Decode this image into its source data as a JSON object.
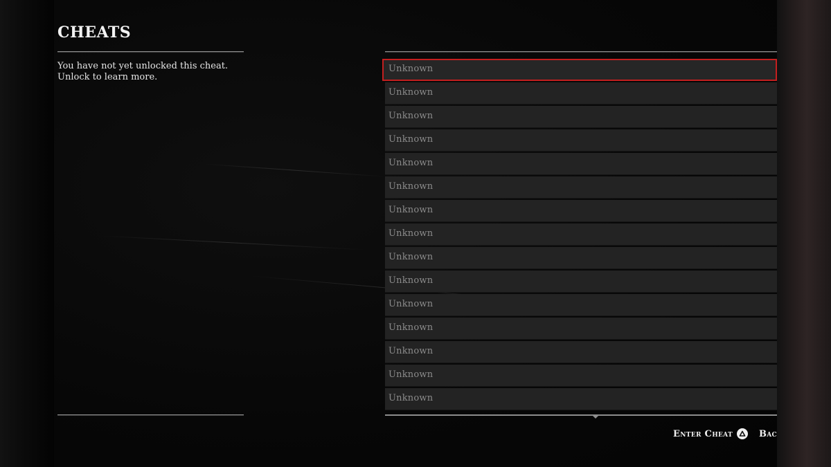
{
  "panel": {
    "title": "CHEATS",
    "description_line1": "You have not yet unlocked this cheat.",
    "description_line2": "Unlock to learn more."
  },
  "cheat_list": {
    "selected_index": 0,
    "items": [
      {
        "label": "Unknown"
      },
      {
        "label": "Unknown"
      },
      {
        "label": "Unknown"
      },
      {
        "label": "Unknown"
      },
      {
        "label": "Unknown"
      },
      {
        "label": "Unknown"
      },
      {
        "label": "Unknown"
      },
      {
        "label": "Unknown"
      },
      {
        "label": "Unknown"
      },
      {
        "label": "Unknown"
      },
      {
        "label": "Unknown"
      },
      {
        "label": "Unknown"
      },
      {
        "label": "Unknown"
      },
      {
        "label": "Unknown"
      },
      {
        "label": "Unknown"
      }
    ]
  },
  "footer": {
    "enter_cheat_label": "Enter Cheat",
    "enter_cheat_icon": "triangle-button-icon",
    "back_label": "Bac"
  },
  "colors": {
    "selection_outline": "#c41f1f",
    "row_background": "#232323",
    "background": "#000000"
  }
}
